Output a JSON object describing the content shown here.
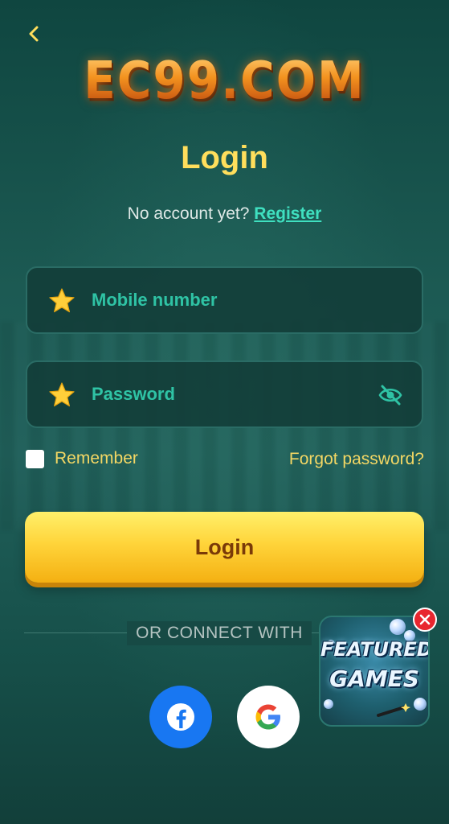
{
  "logo_text": "EC99.COM",
  "title": "Login",
  "register_prompt": "No account yet?",
  "register_link": "Register",
  "mobile": {
    "placeholder": "Mobile number",
    "value": ""
  },
  "password": {
    "placeholder": "Password",
    "value": ""
  },
  "remember_label": "Remember",
  "forgot_label": "Forgot password?",
  "login_button": "Login",
  "or_connect": "OR CONNECT WITH",
  "featured": {
    "line1": "FEATURED",
    "line2": "GAMES"
  },
  "icons": {
    "back": "chevron-left-icon",
    "field_marker": "star-icon",
    "password_toggle": "eye-off-icon",
    "facebook": "facebook-icon",
    "google": "google-icon",
    "close": "close-icon"
  },
  "colors": {
    "accent_yellow": "#ffde5c",
    "link_teal": "#3fe0c0",
    "field_text": "#2fc3a5",
    "button_gold": "#ffd43a",
    "button_text": "#7a3a08",
    "facebook_blue": "#1877f2",
    "close_red": "#e8262f"
  }
}
